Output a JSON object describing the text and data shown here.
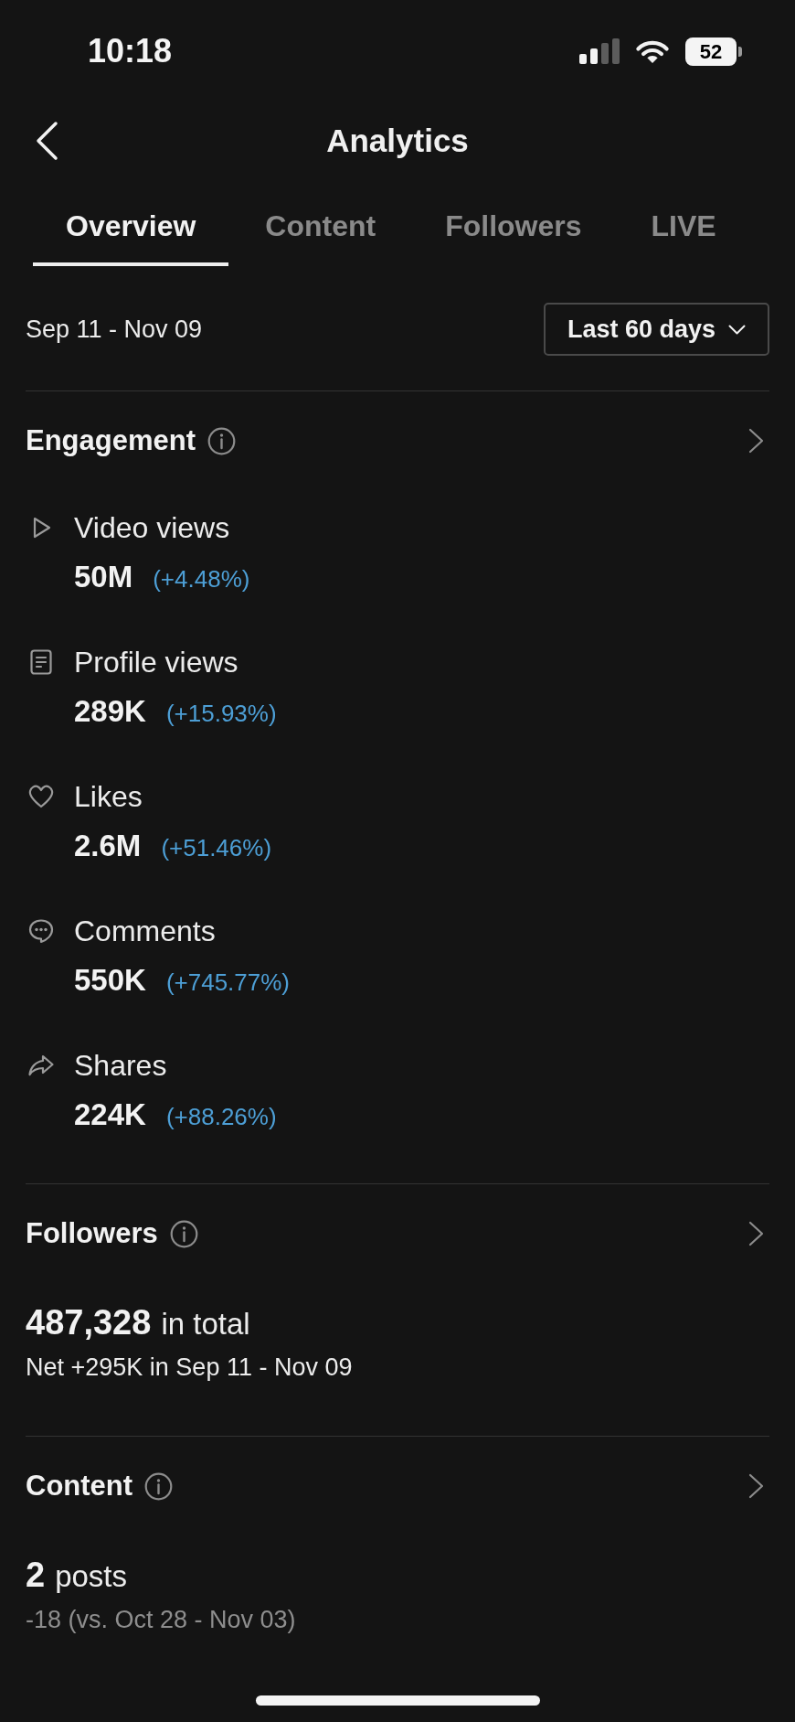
{
  "status_bar": {
    "time": "10:18",
    "battery": "52"
  },
  "header": {
    "title": "Analytics"
  },
  "tabs": [
    {
      "label": "Overview",
      "selected": true
    },
    {
      "label": "Content",
      "selected": false
    },
    {
      "label": "Followers",
      "selected": false
    },
    {
      "label": "LIVE",
      "selected": false
    }
  ],
  "date_filter": {
    "range": "Sep 11 - Nov 09",
    "period": "Last 60 days"
  },
  "engagement": {
    "title": "Engagement",
    "metrics": [
      {
        "kind": "video",
        "label": "Video views",
        "value": "50M",
        "change": "(+4.48%)"
      },
      {
        "kind": "profile",
        "label": "Profile views",
        "value": "289K",
        "change": "(+15.93%)"
      },
      {
        "kind": "likes",
        "label": "Likes",
        "value": "2.6M",
        "change": "(+51.46%)"
      },
      {
        "kind": "comments",
        "label": "Comments",
        "value": "550K",
        "change": "(+745.77%)"
      },
      {
        "kind": "shares",
        "label": "Shares",
        "value": "224K",
        "change": "(+88.26%)"
      }
    ]
  },
  "followers": {
    "title": "Followers",
    "total": "487,328",
    "total_label": "in total",
    "net": "Net +295K in Sep 11 - Nov 09"
  },
  "content": {
    "title": "Content",
    "count": "2",
    "count_label": "posts",
    "comparison": "-18 (vs. Oct 28 - Nov 03)"
  }
}
